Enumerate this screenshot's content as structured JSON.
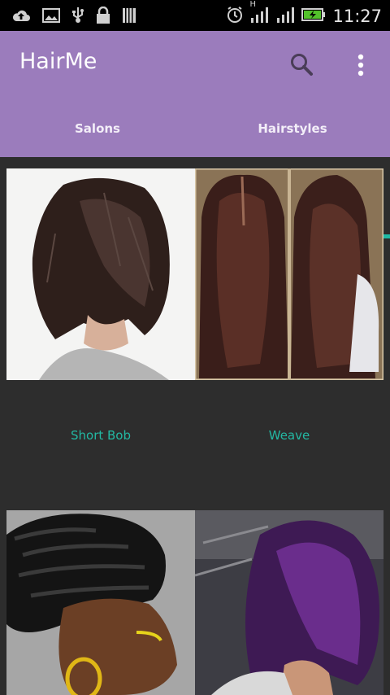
{
  "status_bar": {
    "time": "11:27",
    "icons": [
      "cloud-upload-icon",
      "image-icon",
      "usb-icon",
      "lock-icon",
      "barcode-icon",
      "alarm-icon",
      "signal-h-icon",
      "signal-icon",
      "battery-charging-icon"
    ],
    "network_label": "H"
  },
  "app_bar": {
    "title": "HairMe",
    "background": "#9b7cbc",
    "actions": [
      "search-icon",
      "overflow-menu-icon"
    ]
  },
  "tabs": [
    {
      "label": "Salons",
      "selected": false
    },
    {
      "label": "Hairstyles",
      "selected": true
    }
  ],
  "accent": "#1fbba6",
  "hairstyles": [
    {
      "name": "Short Bob"
    },
    {
      "name": "Weave"
    },
    {
      "name": ""
    },
    {
      "name": ""
    }
  ]
}
